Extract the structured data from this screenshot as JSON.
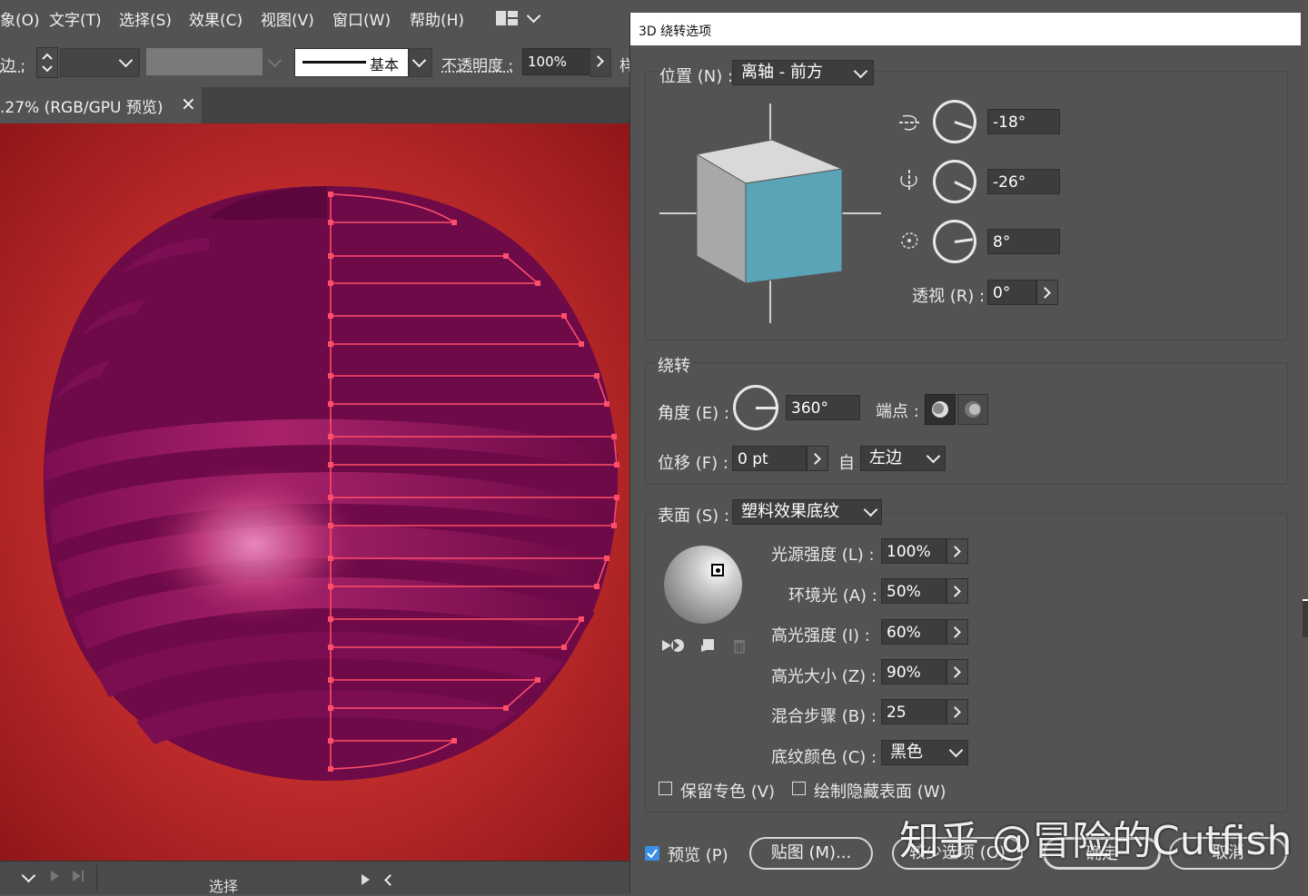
{
  "menubar": {
    "items": [
      "象(O)",
      "文字(T)",
      "选择(S)",
      "效果(C)",
      "视图(V)",
      "窗口(W)",
      "帮助(H)"
    ]
  },
  "controlbar": {
    "stroke_label": "边 :",
    "brush_label": "基本",
    "opacity_label": "不透明度 :",
    "opacity_value": "100%",
    "more": "样"
  },
  "document": {
    "tab_title": ".27% (RGB/GPU 预览)",
    "close": "×"
  },
  "statusbar": {
    "tool_label": "选择"
  },
  "dialog": {
    "title": "3D 绕转选项",
    "position_label": "位置 (N) :",
    "position_value": "离轴 - 前方",
    "rot_x": "-18°",
    "rot_y": "-26°",
    "rot_z": "8°",
    "perspective_label": "透视 (R) :",
    "perspective_value": "0°",
    "revolve_section": "绕转",
    "angle_label": "角度 (E) :",
    "angle_value": "360°",
    "cap_label": "端点 :",
    "offset_label": "位移 (F) :",
    "offset_value": "0 pt",
    "from_label": "自",
    "from_value": "左边",
    "surface_label": "表面 (S) :",
    "surface_value": "塑料效果底纹",
    "light_intensity_label": "光源强度 (L) :",
    "light_intensity_value": "100%",
    "ambient_label": "环境光 (A) :",
    "ambient_value": "50%",
    "highlight_intensity_label": "高光强度 (I) :",
    "highlight_intensity_value": "60%",
    "highlight_size_label": "高光大小 (Z) :",
    "highlight_size_value": "90%",
    "blend_steps_label": "混合步骤 (B) :",
    "blend_steps_value": "25",
    "shading_color_label": "底纹颜色 (C) :",
    "shading_color_value": "黑色",
    "preserve_spot_label": "保留专色 (V)",
    "draw_hidden_label": "绘制隐藏表面 (W)",
    "preview_label": "预览 (P)",
    "map_button": "贴图 (M)...",
    "fewer_options_button": "较少选项 (O)",
    "ok_button": "确定",
    "cancel_button": "取消"
  },
  "watermark": "知乎 @冒险的Cutfish",
  "colors": {
    "accent_cube": "#5aa4b8",
    "sphere": "#6e0a48",
    "canvas_red": "#c93030",
    "path": "#ff4d6a"
  }
}
